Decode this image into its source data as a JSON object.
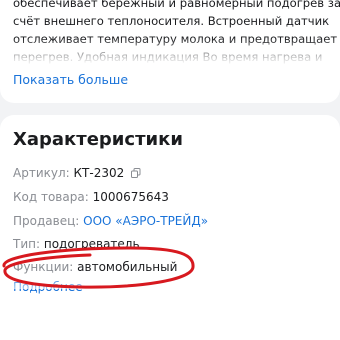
{
  "description": {
    "lines": [
      "обеспечивает бережный и равномерный подогрев за",
      "счёт внешнего теплоносителя. Встроенный датчик",
      "отслеживает температуру молока и предотвращает",
      "перегрев. Удобная индикация Во время нагрева и"
    ],
    "show_more": "Показать больше"
  },
  "specs": {
    "title": "Характеристики",
    "rows": [
      {
        "label": "Артикул:",
        "value": "КТ-2302"
      },
      {
        "label": "Код товара:",
        "value": "1000675643"
      },
      {
        "label": "Продавец:",
        "value": "ООО «АЭРО-ТРЕЙД»"
      },
      {
        "label": "Тип:",
        "value": "подогреватель"
      },
      {
        "label": "Функции:",
        "value": "автомобильный"
      }
    ],
    "details_link": "Подробнее"
  },
  "colors": {
    "accent": "#1a73d9",
    "marker": "#d7191f",
    "label": "#8a8d93",
    "text": "#1b1c1f",
    "background": "#f2f3f5"
  },
  "icons": {
    "copy": "copy-icon"
  }
}
